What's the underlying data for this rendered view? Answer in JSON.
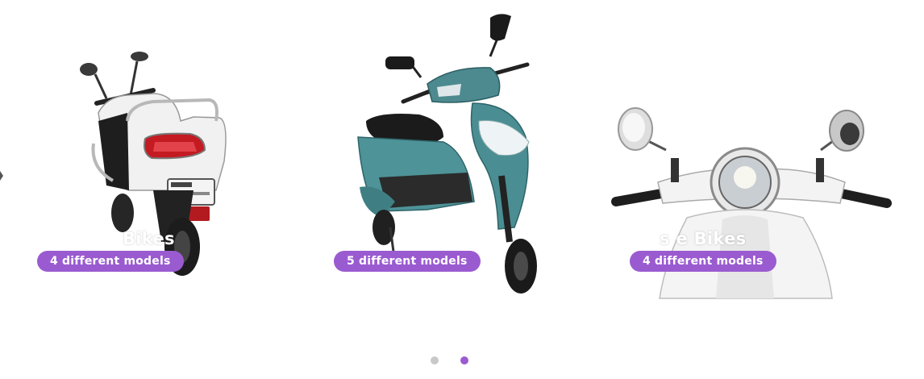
{
  "carousel": {
    "slides": [
      {
        "title": "Bikes",
        "badge": "4 different models"
      },
      {
        "title": "",
        "badge": "5 different models"
      },
      {
        "title": "s e Bikes",
        "badge": "4 different models"
      }
    ],
    "pagination": {
      "count": 2,
      "active_index": 1
    }
  },
  "colors": {
    "badge": "#9a5bd0",
    "dot_active": "#9a5bd0",
    "dot_inactive": "#c8c8c8"
  }
}
